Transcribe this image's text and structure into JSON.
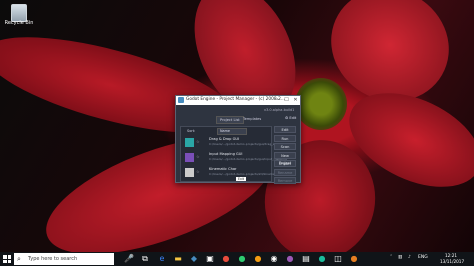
{
  "desktop": {
    "recycle_bin_label": "Recycle Bin"
  },
  "window": {
    "title": "Godot Engine - Project Manager - (c) 2008-2...",
    "controls": [
      "–",
      "☐",
      "✕"
    ],
    "version": "v3.0.alpha.build1",
    "tabs": [
      "Project List",
      "Templates"
    ],
    "edit_label": "⚙ Edit",
    "sort_label": "Sort:",
    "sort_value": "Name",
    "projects": [
      {
        "name": "Drag & Drop GUI",
        "path": "C:/Users/.../godot-demo-projects/gui/drag_and_drop",
        "icon_color": "#2aa6a6"
      },
      {
        "name": "Input Mapping GUI",
        "path": "C:/Users/.../godot-demo-projects/gui/input_mapping",
        "icon_color": "#7a4fb8"
      },
      {
        "name": "Kinematic Char",
        "path": "C:/Users/.../godot-demo-projects/2d/kinematic_char",
        "icon_color": "#cccccc"
      }
    ],
    "buttons": [
      "Edit",
      "Run",
      "Scan",
      "New Project",
      "Import",
      "Rename",
      "Remove"
    ],
    "tooltip": "Exit"
  },
  "taskbar": {
    "search_placeholder": "Type here to search",
    "language": "ENG",
    "time": "12:21",
    "date": "13/11/2017"
  }
}
